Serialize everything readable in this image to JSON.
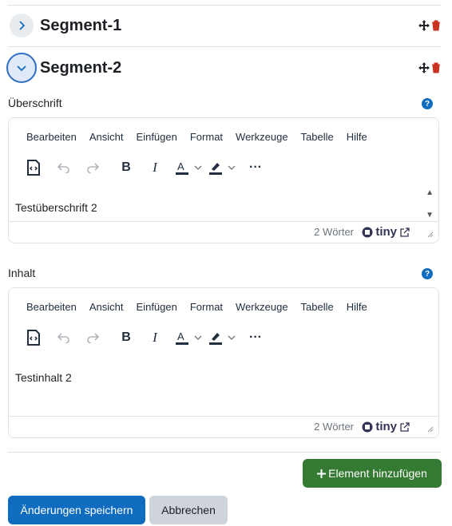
{
  "segments": [
    {
      "title": "Segment-1",
      "expanded": false
    },
    {
      "title": "Segment-2",
      "expanded": true
    }
  ],
  "editors": [
    {
      "label": "Überschrift",
      "menu": [
        "Bearbeiten",
        "Ansicht",
        "Einfügen",
        "Format",
        "Werkzeuge",
        "Tabelle",
        "Hilfe"
      ],
      "content": "Testüberschrift 2",
      "word_count": "2 Wörter",
      "brand": "tiny"
    },
    {
      "label": "Inhalt",
      "menu": [
        "Bearbeiten",
        "Ansicht",
        "Einfügen",
        "Format",
        "Werkzeuge",
        "Tabelle",
        "Hilfe"
      ],
      "content": "Testinhalt 2",
      "word_count": "2 Wörter",
      "brand": "tiny"
    }
  ],
  "buttons": {
    "add_element": "Element hinzufügen",
    "save": "Änderungen speichern",
    "cancel": "Abbrechen"
  },
  "colors": {
    "accent": "#0f6cbf",
    "success": "#357a32",
    "danger": "#ca3120"
  }
}
